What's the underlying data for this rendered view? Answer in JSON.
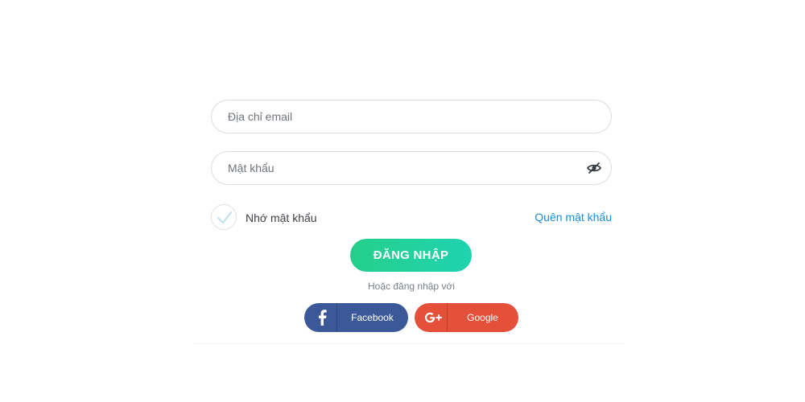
{
  "login_form": {
    "email_placeholder": "Địa chỉ email",
    "email_value": "",
    "password_placeholder": "Mật khẩu",
    "password_value": "",
    "password_toggle_icon": "eye-slash-icon",
    "remember_label": "Nhớ mật khẩu",
    "remember_checked": false,
    "forgot_link": "Quên mật khẩu",
    "login_button": "ĐĂNG NHẬP",
    "or_text": "Hoặc đăng nhập với"
  },
  "social": {
    "facebook": {
      "label": "Facebook",
      "icon": "facebook-icon",
      "color": "#3b5998"
    },
    "google": {
      "label": "Google",
      "icon": "google-plus-icon",
      "color": "#e4503a"
    }
  },
  "colors": {
    "primary_gradient_start": "#25cf8a",
    "primary_gradient_end": "#1fd3b0",
    "link": "#1c8ed9",
    "field_border": "#d9dde3",
    "check_mark": "#bfe3ef"
  }
}
